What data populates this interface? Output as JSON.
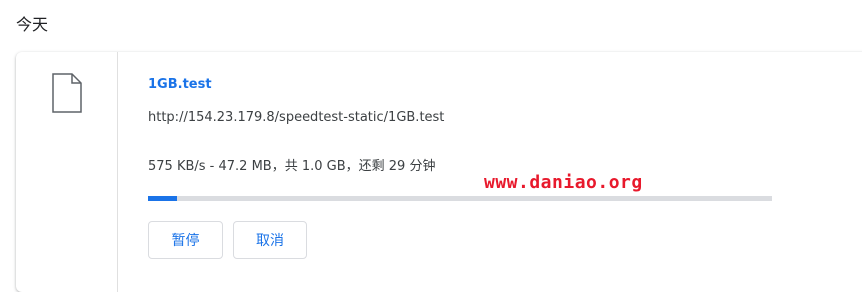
{
  "section": {
    "header": "今天"
  },
  "download": {
    "file_icon": "file-icon",
    "file_name": "1GB.test",
    "url": "http://154.23.179.8/speedtest-static/1GB.test",
    "status": "575 KB/s - 47.2 MB，共 1.0 GB，还剩 29 分钟",
    "progress_fraction": 0.047,
    "pause_label": "暂停",
    "cancel_label": "取消"
  },
  "watermark": "www.daniao.org",
  "colors": {
    "accent": "#1a73e8",
    "watermark": "#e8192c",
    "track": "#dadce0"
  }
}
